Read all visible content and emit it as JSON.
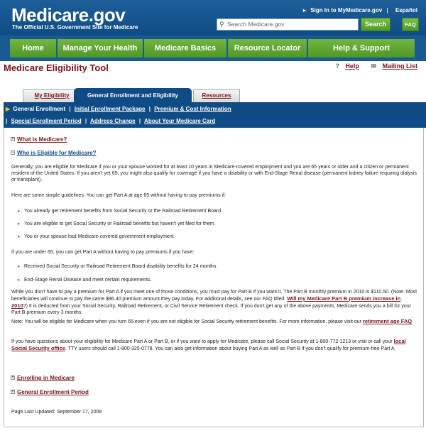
{
  "header": {
    "logo": "Medicare.gov",
    "tagline": "The Official U.S. Government Site for Medicare",
    "signin": "Sign In to MyMedicare.gov",
    "espanol": "Español",
    "search_placeholder": "Search Medicare.gov",
    "search_button": "Search",
    "faq_button": "FAQ"
  },
  "nav": [
    "Home",
    "Manage Your Health",
    "Medicare Basics",
    "Resource Locator",
    "Help & Support"
  ],
  "page": {
    "title": "Medicare Eligibility Tool",
    "help": "Help",
    "mailing_list": "Mailing List"
  },
  "tabs": [
    "My Eligibility",
    "General Enrollment and Eligibility",
    "Resources"
  ],
  "subnav": {
    "row1": [
      "General Enrollment",
      "Initial Enrollment Package",
      "Premium & Cost Information"
    ],
    "row2": [
      "Special Enrollment Period",
      "Address Change",
      "About Your Medicare Card"
    ]
  },
  "content": {
    "toggle_what": "What Is Medicare?",
    "toggle_who": "Who is Eligible for Medicare?",
    "p1": "Generally, you are eligible for Medicare if you or your spouse worked for at least 10 years in Medicare-covered employment and you are 65 years or older and a citizen or permanent resident of the United States. If you aren't yet 65, you might also qualify for coverage if you have a disability or with End-Stage Renal disease (permanent kidney failure requiring dialysis or transplant).",
    "p2": "Here are some simple guidelines. You can get Part A at age 65 without having to pay premiums if:",
    "b1": "You already get retirement benefits from Social Security or the Railroad Retirement Board.",
    "b2": "You are eligible to get Social Security or Railroad benefits but haven't yet filed for them.",
    "b3": "You or your spouse had Medicare-covered government employment.",
    "p3": "If you are under 65, you can get Part A without having to pay premiums if you have:",
    "b4": "Received Social Security or Railroad Retirement Board disability benefits for 24 months.",
    "b5": "End-Stage Renal Disease and meet certain requirements.",
    "p4a": "While you don't have to pay a premium for Part A if you meet one of those conditions, you must pay for Part B if you want it. The Part B monthly premium in 2010 is $110.50. (Note: Most beneficiaries will continue to pay the same $96.40 premium amount they pay today. For additional details, see our FAQ titled:",
    "p4_link": "Will my Medicare Part B premium increase in 2010",
    "p4b": "?) It is deducted from your Social Security, Railroad Retirement, or Civil Service Retirement check. If you don't get any of the above payments, Medicare sends you a bill for your Part B premium every 3 months.",
    "p5a": "Note: You will be eligible for Medicare when you turn 65 even if you are not eligible for Social Security retirement benefits. For more information, please visit our",
    "p5_link": "retirement age FAQ",
    "p6a": "If you have questions about your eligibility for Medicare Part A or Part B, or if you want to apply for Medicare, please call Social Security at 1-800-772-1213 or visit or call your",
    "p6_link": "local Social Security office",
    "p6b": ". TTY users should call 1-800-325-0778. You can also get information about buying Part A as well as Part B if you don't qualify for premium-free Part A.",
    "toggle_enrolling": "Enrolling in Medicare",
    "toggle_gep": "General Enrollment Period",
    "updated": "Page Last Updated: September 17, 2008"
  }
}
